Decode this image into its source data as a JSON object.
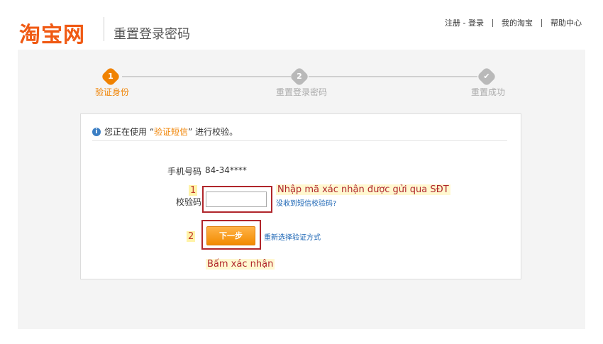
{
  "header": {
    "logo_text": "淘宝网",
    "page_heading": "重置登录密码",
    "nav": [
      "注册 - 登录",
      "我的淘宝",
      "帮助中心"
    ]
  },
  "steps": [
    {
      "number": "1",
      "label": "验证身份",
      "state": "active"
    },
    {
      "number": "2",
      "label": "重置登录密码",
      "state": "pending"
    },
    {
      "number": "✔",
      "label": "重置成功",
      "state": "pending"
    }
  ],
  "info": {
    "prefix": "您正在使用 “",
    "method": "验证短信",
    "suffix": "” 进行校验。"
  },
  "form": {
    "phone_label": "手机号码",
    "phone_value": "84-34****",
    "code_label": "校验码",
    "code_value": "",
    "no_code_link": "没收到短信校验码?",
    "next_button": "下一步",
    "reselect_link": "重新选择验证方式"
  },
  "annotations": {
    "num1": "1",
    "text1": "Nhập mã xác nhận được gửi qua SĐT",
    "num2": "2",
    "text2": "Bấm xác nhận"
  },
  "colors": {
    "brand_orange": "#f05a14",
    "active_step": "#f08200",
    "pending_step": "#b9b9b9",
    "annotation_red": "#b0262b"
  }
}
